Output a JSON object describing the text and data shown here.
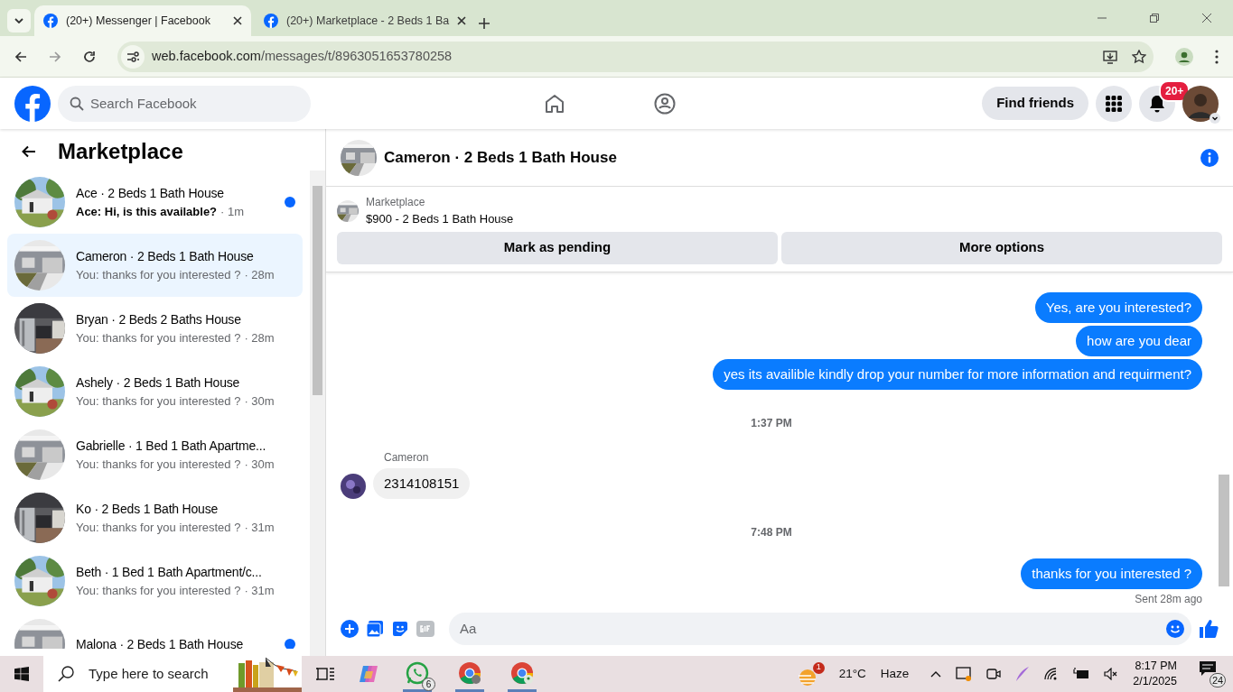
{
  "browser": {
    "tabs": [
      {
        "title": "(20+) Messenger | Facebook",
        "selected": true
      },
      {
        "title": "(20+) Marketplace - 2 Beds 1 Ba",
        "selected": false
      }
    ],
    "url_host": "web.facebook.com",
    "url_path": "/messages/t/8963051653780258"
  },
  "header": {
    "search_placeholder": "Search Facebook",
    "find_friends": "Find friends",
    "notification_count": "20+"
  },
  "sidebar": {
    "title": "Marketplace",
    "conversations": [
      {
        "title": "Ace · 2 Beds 1 Bath House",
        "preview": "Ace: Hi, is this available?",
        "time": "· 1m",
        "unread": true,
        "selected": false
      },
      {
        "title": "Cameron · 2 Beds 1 Bath House",
        "preview": "You: thanks for you interested ?",
        "time": "· 28m",
        "unread": false,
        "selected": true
      },
      {
        "title": "Bryan · 2 Beds 2 Baths House",
        "preview": "You: thanks for you interested ?",
        "time": "· 28m",
        "unread": false,
        "selected": false
      },
      {
        "title": "Ashely · 2 Beds 1 Bath House",
        "preview": "You: thanks for you interested ?",
        "time": "· 30m",
        "unread": false,
        "selected": false
      },
      {
        "title": "Gabrielle · 1 Bed 1 Bath Apartme...",
        "preview": "You: thanks for you interested ?",
        "time": "· 30m",
        "unread": false,
        "selected": false
      },
      {
        "title": "Ko · 2 Beds 1 Bath House",
        "preview": "You: thanks for you interested ?",
        "time": "· 31m",
        "unread": false,
        "selected": false
      },
      {
        "title": "Beth · 1 Bed 1 Bath Apartment/c...",
        "preview": "You: thanks for you interested ?",
        "time": "· 31m",
        "unread": false,
        "selected": false
      },
      {
        "title": "Malona · 2 Beds 1 Bath House",
        "unread": true,
        "selected": false
      }
    ]
  },
  "chat": {
    "title": "Cameron · 2 Beds 1 Bath House",
    "listing": {
      "label": "Marketplace",
      "summary": "$900 - 2 Beds 1 Bath House"
    },
    "actions": [
      "Mark as pending",
      "More options"
    ],
    "messages": [
      {
        "kind": "sent",
        "text": "Yes, are you interested?"
      },
      {
        "kind": "sent",
        "text": "how are you dear"
      },
      {
        "kind": "sent",
        "text": "yes its availible kindly drop your number for more information and requirment?"
      },
      {
        "kind": "timestamp",
        "text": "1:37 PM"
      },
      {
        "kind": "received",
        "sender": "Cameron",
        "text": "2314108151"
      },
      {
        "kind": "timestamp",
        "text": "7:48 PM"
      },
      {
        "kind": "sent",
        "text": "thanks for you interested ?"
      }
    ],
    "status": "Sent 28m ago",
    "composer": {
      "placeholder": "Aa"
    }
  },
  "taskbar": {
    "search_placeholder": "Type here to search",
    "whatsapp_badge": "6",
    "weather_badge": "1",
    "temperature": "21°C",
    "condition": "Haze",
    "time": "8:17 PM",
    "date": "2/1/2025",
    "notification_count": "24"
  }
}
